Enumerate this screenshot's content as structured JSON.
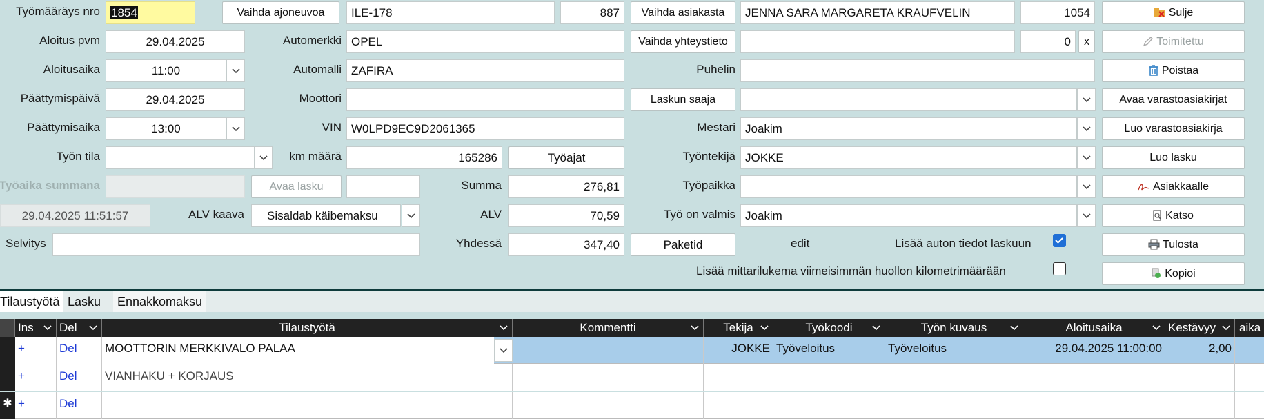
{
  "header": {
    "workorder_label": "Työmääräys nro",
    "workorder_value": "1854",
    "change_vehicle": "Vaihda ajoneuvoa",
    "reg_plate": "ILE-178",
    "vehicle_id": "887",
    "change_customer": "Vaihda asiakasta",
    "customer_name": "JENNA SARA MARGARETA KRAUFVELIN",
    "customer_id": "1054",
    "start_date_label": "Aloitus pvm",
    "start_date": "29.04.2025",
    "make_label": "Automerkki",
    "make": "OPEL",
    "change_contact": "Vaihda yhteystieto",
    "contact_value": "",
    "contact_id": "0",
    "contact_clear": "x",
    "start_time_label": "Aloitusaika",
    "start_time": "11:00",
    "model_label": "Automalli",
    "model": "ZAFIRA",
    "phone_label": "Puhelin",
    "phone": "",
    "end_date_label": "Päättymispäivä",
    "end_date": "29.04.2025",
    "engine_label": "Moottori",
    "engine": "",
    "invoice_recipient": "Laskun saaja",
    "invoice_recipient_value": "",
    "end_time_label": "Päättymisaika",
    "end_time": "13:00",
    "vin_label": "VIN",
    "vin": "W0LPD9EC9D2061365",
    "master_label": "Mestari",
    "master": "Joakim",
    "status_label": "Työn tila",
    "status": "",
    "km_label": "km määrä",
    "km": "165286",
    "work_times": "Työajat",
    "worker_label": "Työntekijä",
    "worker": "JOKKE",
    "work_sum_label": "Työaika summana",
    "work_sum": "",
    "open_invoice": "Avaa lasku",
    "open_invoice_value": "",
    "sum_label": "Summa",
    "sum": "276,81",
    "workplace_label": "Työpaikka",
    "workplace": "",
    "timestamp": "29.04.2025 11:51:57",
    "vat_formula_label": "ALV kaava",
    "vat_formula": "Sisaldab käibemaksu",
    "vat_label": "ALV",
    "vat": "70,59",
    "ready_label": "Työ on valmis",
    "ready": "Joakim",
    "explanation_label": "Selvitys",
    "explanation": "",
    "total_label": "Yhdessä",
    "total": "347,40",
    "packages": "Paketid",
    "edit_text": "edit",
    "add_car_info_label": "Lisää auton tiedot laskuun",
    "add_car_info": true,
    "add_odometer_label": "Lisää mittarilukema viimeisimmän huollon kilometrimäärään",
    "add_odometer": false
  },
  "actions": {
    "close": "Sulje",
    "delivered": "Toimitettu",
    "delete": "Poistaa",
    "open_stock_docs": "Avaa varastoasiakirjat",
    "create_stock_doc": "Luo varastoasiakirja",
    "create_invoice": "Luo lasku",
    "to_customer": "Asiakkaalle",
    "view": "Katso",
    "print": "Tulosta",
    "copy": "Kopioi"
  },
  "tabs": [
    "Tilaustyötä",
    "Lasku",
    "Ennakkomaksu"
  ],
  "grid": {
    "columns": [
      "Ins",
      "Del",
      "Tilaustyötä",
      "Kommentti",
      "Tekija",
      "Työkoodi",
      "Työn kuvaus",
      "Aloitusaika",
      "Kestävyy",
      "aika"
    ],
    "rows": [
      {
        "ins": "+",
        "del": "Del",
        "order": "MOOTTORIN MERKKIVALO PALAA",
        "comment": "",
        "maker": "JOKKE",
        "code": "Työveloitus",
        "desc": "Työveloitus",
        "start": "29.04.2025 11:00:00",
        "duration": "2,00"
      },
      {
        "ins": "+",
        "del": "Del",
        "order": "VIANHAKU + KORJAUS",
        "comment": "",
        "maker": "",
        "code": "",
        "desc": "",
        "start": "",
        "duration": ""
      },
      {
        "ins": "+",
        "del": "Del",
        "order": "",
        "comment": "",
        "maker": "",
        "code": "",
        "desc": "",
        "start": "",
        "duration": ""
      }
    ],
    "new_row_marker": "✱"
  },
  "colors": {
    "background": "#c9dfe0",
    "selected_row": "#a8cdea",
    "highlight": "#fffaa0",
    "link": "#1e3bd6"
  }
}
